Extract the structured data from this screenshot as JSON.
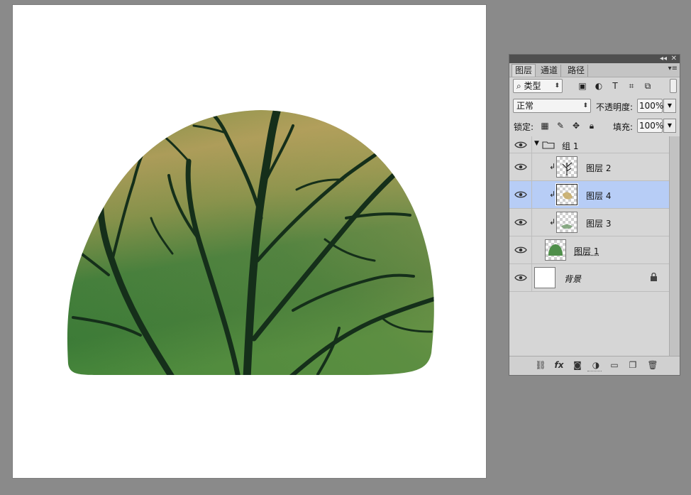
{
  "panel": {
    "topbar": {
      "collapse": "◂◂",
      "close": "✕"
    },
    "tabs": [
      {
        "label": "图层",
        "active": true
      },
      {
        "label": "通道",
        "active": false
      },
      {
        "label": "路径",
        "active": false
      }
    ],
    "menu_icon": "panel-menu-icon",
    "filter": {
      "value": "类型"
    },
    "blend_mode": {
      "value": "正常"
    },
    "opacity": {
      "label": "不透明度:",
      "value": "100%"
    },
    "lock": {
      "label": "锁定:"
    },
    "fill": {
      "label": "填充:",
      "value": "100%"
    },
    "layers": [
      {
        "name": "组 1",
        "kind": "group",
        "expanded": true
      },
      {
        "name": "图层 2",
        "kind": "layer",
        "clipped": true
      },
      {
        "name": "图层 4",
        "kind": "layer",
        "clipped": true,
        "selected": true
      },
      {
        "name": "图层 3",
        "kind": "layer",
        "clipped": true
      },
      {
        "name": "图层 1",
        "kind": "layer"
      },
      {
        "name": "背景",
        "kind": "background",
        "locked": true
      }
    ],
    "accent": "#b7cdf6"
  },
  "canvas": {
    "colors": {
      "green_dark": "#2f6a34",
      "green_light": "#4f8f3f",
      "ochre": "#b39f5c",
      "branch": "#14301a"
    }
  }
}
